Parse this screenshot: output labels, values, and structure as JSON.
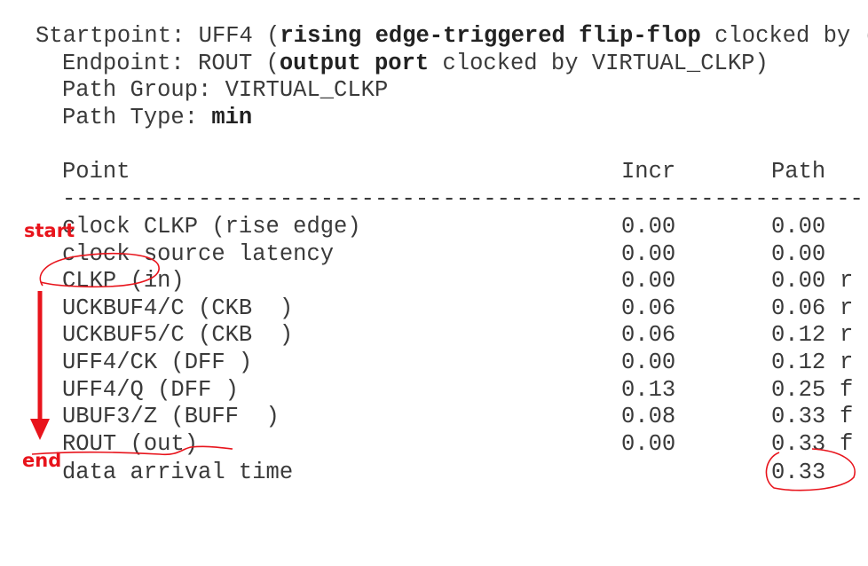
{
  "header": {
    "startpoint_label": "Startpoint: ",
    "startpoint_value": "UFF4 (",
    "startpoint_bold": "rising edge-triggered flip-flop",
    "startpoint_tail": " clocked by (",
    "endpoint_label": "Endpoint: ",
    "endpoint_value": "ROUT (",
    "endpoint_bold": "output port",
    "endpoint_tail": " clocked by VIRTUAL_CLKP)",
    "path_group": "Path Group: VIRTUAL_CLKP",
    "path_type_label": "Path Type: ",
    "path_type_value": "min"
  },
  "table": {
    "columns": [
      "Point",
      "Incr",
      "Path"
    ],
    "separator": "-----------------------------------------------------------",
    "rows": [
      {
        "point": "clock CLKP (rise edge)",
        "incr": "0.00",
        "path": "0.00",
        "flag": ""
      },
      {
        "point": "clock source latency",
        "incr": "0.00",
        "path": "0.00",
        "flag": ""
      },
      {
        "point": "CLKP (in)",
        "incr": "0.00",
        "path": "0.00",
        "flag": "r"
      },
      {
        "point": "UCKBUF4/C (CKB  )",
        "incr": "0.06",
        "path": "0.06",
        "flag": "r"
      },
      {
        "point": "UCKBUF5/C (CKB  )",
        "incr": "0.06",
        "path": "0.12",
        "flag": "r"
      },
      {
        "point": "UFF4/CK (DFF )",
        "incr": "0.00",
        "path": "0.12",
        "flag": "r"
      },
      {
        "point": "UFF4/Q (DFF )",
        "incr": "0.13",
        "path": "0.25",
        "flag": "f"
      },
      {
        "point": "UBUF3/Z (BUFF  )",
        "incr": "0.08",
        "path": "0.33",
        "flag": "f"
      },
      {
        "point": "ROUT (out)",
        "incr": "0.00",
        "path": "0.33",
        "flag": "f"
      }
    ],
    "arrival_label": "data arrival time",
    "arrival_value": "0.33"
  },
  "annotations": {
    "start": "start",
    "end": "end",
    "color": "#e8141c"
  }
}
